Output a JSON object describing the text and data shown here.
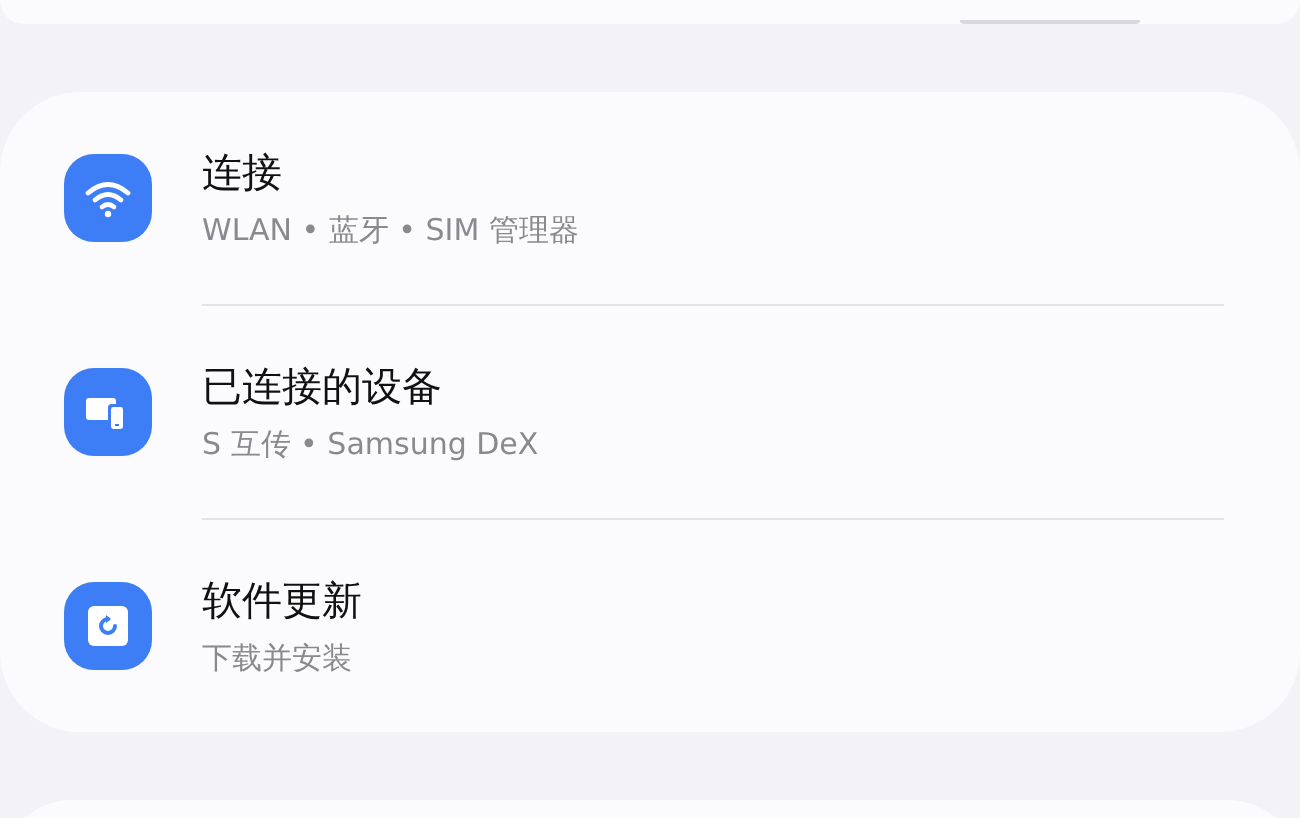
{
  "settings_items": [
    {
      "kind": "wifi",
      "title": "连接",
      "subtitle": "WLAN • 蓝牙 • SIM 管理器"
    },
    {
      "kind": "devices",
      "title": "已连接的设备",
      "subtitle": "S 互传 • Samsung DeX"
    },
    {
      "kind": "update",
      "title": "软件更新",
      "subtitle": "下载并安装"
    }
  ]
}
